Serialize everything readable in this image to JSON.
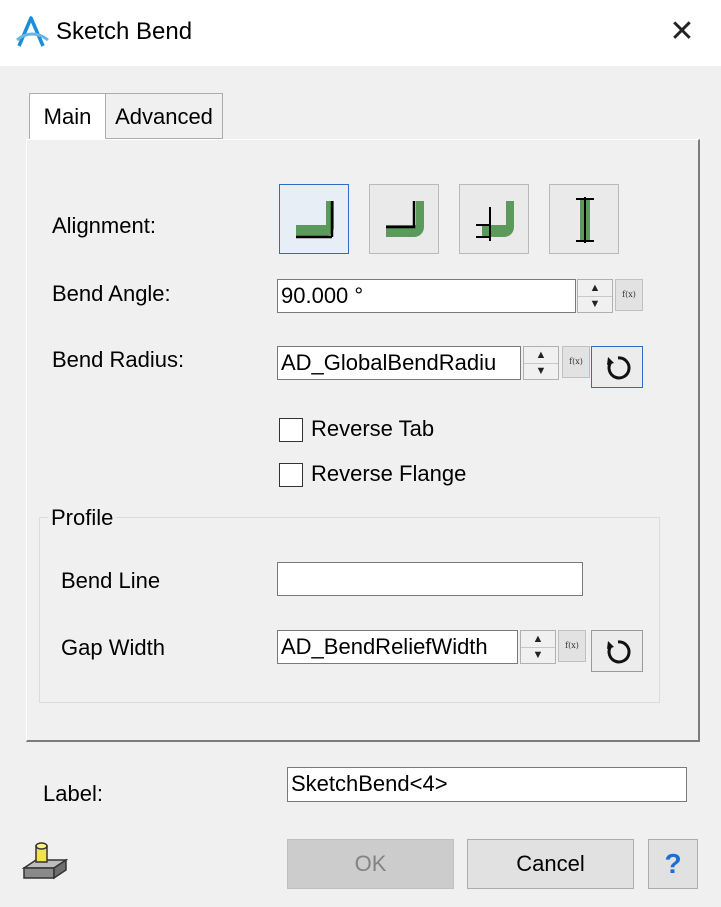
{
  "window": {
    "title": "Sketch Bend",
    "close_icon": "close-icon",
    "app_icon": "altair-logo-icon",
    "accent": "#1a8fd6"
  },
  "tabs": [
    {
      "label": "Main",
      "selected": true
    },
    {
      "label": "Advanced",
      "selected": false
    }
  ],
  "alignment": {
    "label": "Alignment:",
    "options": [
      {
        "name": "align-outside-icon",
        "selected": true
      },
      {
        "name": "align-inside-icon",
        "selected": false
      },
      {
        "name": "align-offset-icon",
        "selected": false
      },
      {
        "name": "align-centered-icon",
        "selected": false
      }
    ],
    "shape_color": "#5b9a5a"
  },
  "bend_angle": {
    "label": "Bend Angle:",
    "value": "90.000 °",
    "fx": "f(x)"
  },
  "bend_radius": {
    "label": "Bend Radius:",
    "value": "AD_GlobalBendRadiu",
    "fx": "f(x)",
    "reset_icon": "reset-icon"
  },
  "reverse_tab": {
    "label": "Reverse Tab",
    "checked": false
  },
  "reverse_flange": {
    "label": "Reverse Flange",
    "checked": false
  },
  "profile": {
    "title": "Profile",
    "bend_line": {
      "label": "Bend Line",
      "value": ""
    },
    "gap_width": {
      "label": "Gap Width",
      "value": "AD_BendReliefWidth",
      "fx": "f(x)",
      "reset_icon": "reset-icon"
    }
  },
  "label_field": {
    "label": "Label:",
    "value": "SketchBend<4>"
  },
  "buttons": {
    "ok": "OK",
    "cancel": "Cancel",
    "help": "?"
  },
  "part_icon": "part-icon"
}
